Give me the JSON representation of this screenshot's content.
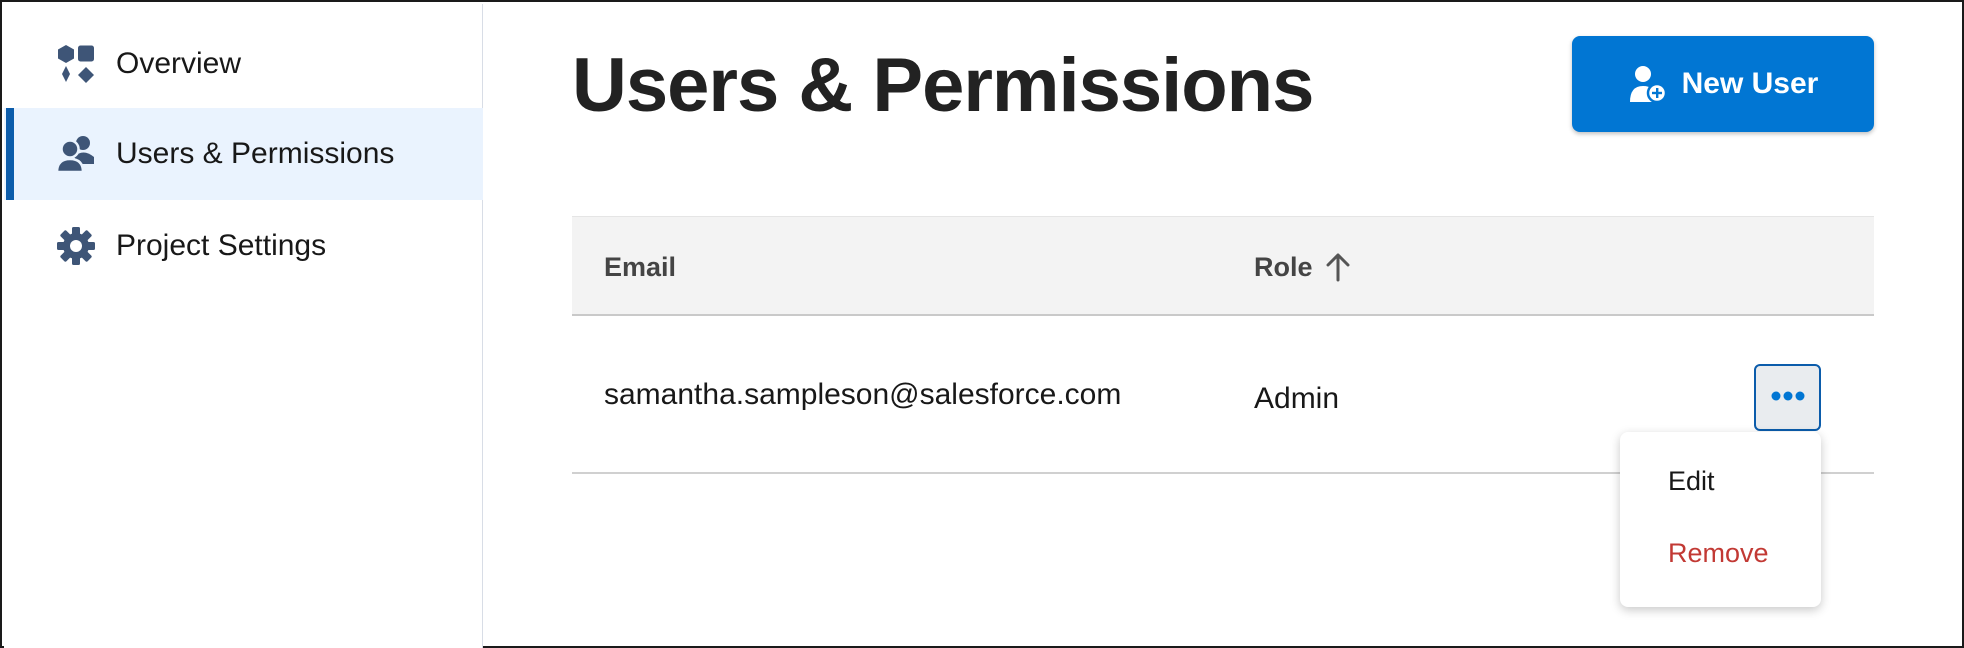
{
  "sidebar": {
    "items": [
      {
        "label": "Overview",
        "icon": "shapes-icon",
        "active": false
      },
      {
        "label": "Users & Permissions",
        "icon": "users-icon",
        "active": true
      },
      {
        "label": "Project Settings",
        "icon": "gear-icon",
        "active": false
      }
    ]
  },
  "main": {
    "title": "Users & Permissions",
    "new_user_label": "New User",
    "new_user_icon": "add-user-icon"
  },
  "table": {
    "columns": [
      {
        "label": "Email"
      },
      {
        "label": "Role",
        "sort": "ascending",
        "sort_icon": "arrow-up-icon"
      }
    ],
    "rows": [
      {
        "email": "samantha.sampleson@salesforce.com",
        "role": "Admin"
      }
    ]
  },
  "row_menu": {
    "trigger_icon": "more-horizontal-icon",
    "items": [
      {
        "label": "Edit"
      },
      {
        "label": "Remove"
      }
    ]
  },
  "colors": {
    "brand": "#0176d3",
    "active_nav_bg": "#eaf3fe",
    "active_nav_bar": "#0b5cab",
    "icon": "#3e5577",
    "danger": "#c23934"
  }
}
